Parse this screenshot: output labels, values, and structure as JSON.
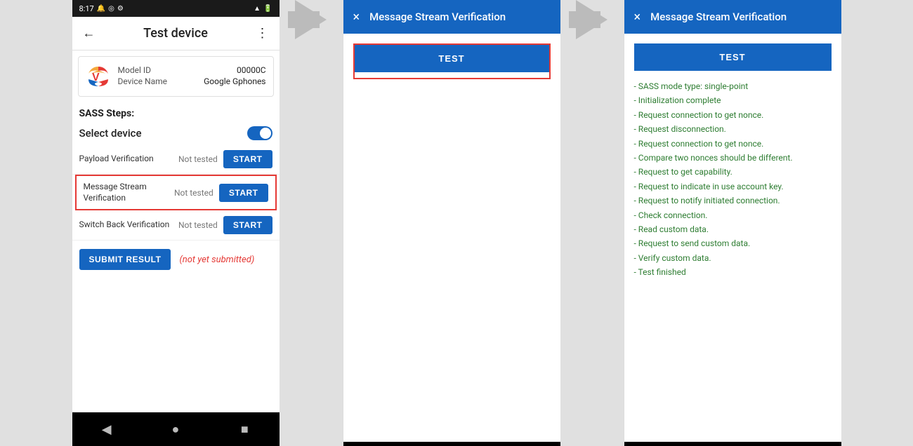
{
  "statusBar": {
    "time": "8:17",
    "icons": [
      "notification",
      "location",
      "settings",
      "wifi",
      "battery"
    ]
  },
  "phone": {
    "topBar": {
      "backIcon": "←",
      "title": "Test device",
      "menuIcon": "⋮"
    },
    "deviceInfo": {
      "modelIdLabel": "Model ID",
      "modelIdValue": "00000C",
      "deviceNameLabel": "Device Name",
      "deviceNameValue": "Google Gphones"
    },
    "sassStepsLabel": "SASS Steps:",
    "selectDeviceLabel": "Select device",
    "steps": [
      {
        "label": "Payload Verification",
        "status": "Not tested",
        "btnLabel": "START",
        "highlighted": false
      },
      {
        "label": "Message Stream\nVerification",
        "status": "Not tested",
        "btnLabel": "START",
        "highlighted": true
      },
      {
        "label": "Switch Back Verification",
        "status": "Not tested",
        "btnLabel": "START",
        "highlighted": false
      }
    ],
    "submitBtnLabel": "SUBMIT RESULT",
    "notSubmittedText": "(not yet submitted)",
    "navBack": "◀",
    "navHome": "●",
    "navRecent": "■"
  },
  "dialog1": {
    "closeIcon": "×",
    "title": "Message Stream Verification",
    "testBtnLabel": "TEST",
    "hasRedBorder": true
  },
  "dialog2": {
    "closeIcon": "×",
    "title": "Message Stream Verification",
    "testBtnLabel": "TEST",
    "resultLines": [
      "- SASS mode type: single-point",
      "- Initialization complete",
      "- Request connection to get nonce.",
      "- Request disconnection.",
      "- Request connection to get nonce.",
      "- Compare two nonces should be different.",
      "- Request to get capability.",
      "- Request to indicate in use account key.",
      "- Request to notify initiated connection.",
      "- Check connection.",
      "- Read custom data.",
      "- Request to send custom data.",
      "- Verify custom data.",
      "- Test finished"
    ]
  }
}
